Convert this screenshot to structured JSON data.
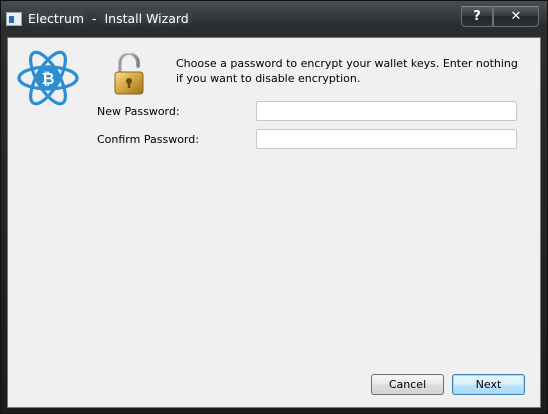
{
  "window": {
    "title": "Electrum  -  Install Wizard",
    "help_label": "?",
    "close_label": "✕"
  },
  "wizard": {
    "intro": "Choose a password to encrypt your wallet keys.  Enter nothing if you want to disable encryption.",
    "new_password_label": "New Password:",
    "new_password_value": "",
    "confirm_password_label": "Confirm Password:",
    "confirm_password_value": ""
  },
  "buttons": {
    "cancel": "Cancel",
    "next": "Next"
  },
  "icons": {
    "app": "electrum-app-icon",
    "logo": "electrum-logo-icon",
    "lock": "unlocked-padlock-icon"
  },
  "colors": {
    "logo_blue": "#2b8fd1",
    "lock_gold": "#d4a640"
  }
}
